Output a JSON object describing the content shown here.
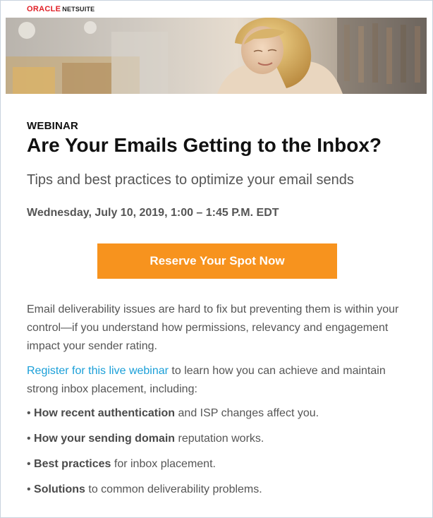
{
  "brand": {
    "oracle": "ORACLE",
    "netsuite": "NETSUITE",
    "oracle_color": "#e01f26"
  },
  "hero": {
    "image": "woman-shopping-banner"
  },
  "webinar": {
    "eyebrow": "WEBINAR",
    "title": "Are Your Emails Getting to the Inbox?",
    "subtitle": "Tips and best practices to optimize your email sends",
    "datetime": "Wednesday, July 10, 2019, 1:00 – 1:45 P.M. EDT"
  },
  "cta": {
    "label": "Reserve Your Spot Now",
    "color": "#f7931e"
  },
  "body": {
    "paragraph1": "Email deliverability issues are hard to fix but preventing them is within your control—if you understand how permissions, relevancy and engagement impact your sender rating.",
    "register_link": "Register for this live webinar",
    "paragraph2_rest": " to learn how you can achieve and maintain strong inbox placement, including:",
    "link_color": "#1a9fd8"
  },
  "bullets": [
    {
      "bold": "How recent authentication",
      "rest": " and ISP changes affect you."
    },
    {
      "bold": "How your sending domain",
      "rest": " reputation works."
    },
    {
      "bold": "Best practices",
      "rest": " for inbox placement."
    },
    {
      "bold": "Solutions",
      "rest": " to common deliverability problems."
    }
  ]
}
